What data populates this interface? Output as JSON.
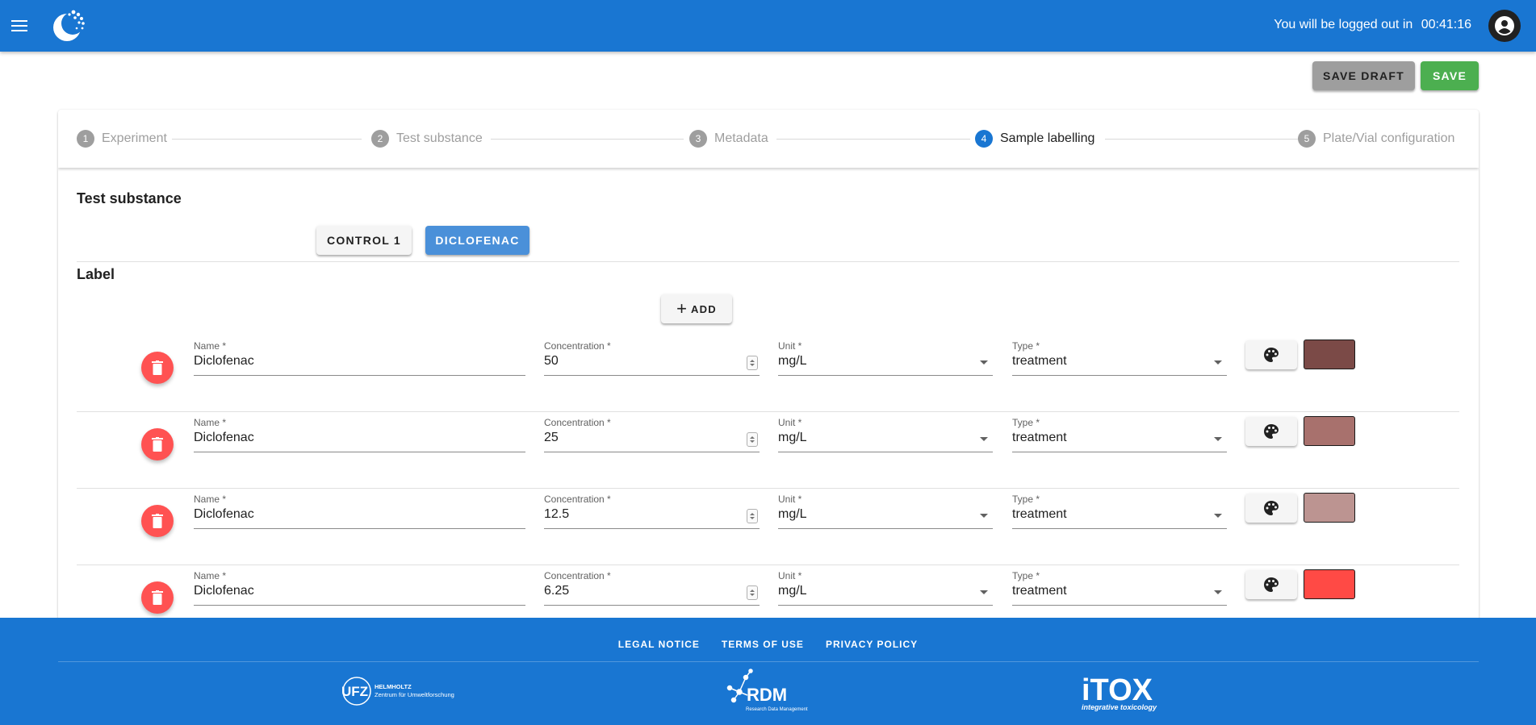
{
  "header": {
    "menu_icon": "menu-icon",
    "logo_icon": "app-logo-icon",
    "logout_prefix": "You will be logged out in",
    "logout_timer": "00:41:16",
    "account_icon": "account-circle-icon"
  },
  "actions": {
    "save_draft": "SAVE DRAFT",
    "save": "SAVE"
  },
  "stepper": {
    "steps": [
      {
        "num": "1",
        "label": "Experiment"
      },
      {
        "num": "2",
        "label": "Test substance"
      },
      {
        "num": "3",
        "label": "Metadata"
      },
      {
        "num": "4",
        "label": "Sample labelling"
      },
      {
        "num": "5",
        "label": "Plate/Vial configuration"
      }
    ],
    "active_step": "4"
  },
  "content": {
    "test_substance_title": "Test substance",
    "substances": [
      "CONTROL 1",
      "DICLOFENAC"
    ],
    "selected_substance": "DICLOFENAC",
    "label_title": "Label",
    "add_label": "ADD"
  },
  "field_labels": {
    "name": "Name *",
    "concentration": "Concentration *",
    "unit": "Unit *",
    "type": "Type *"
  },
  "rows": [
    {
      "name": "Diclofenac",
      "concentration": "50",
      "unit": "mg/L",
      "type": "treatment",
      "color": "#7b4a47"
    },
    {
      "name": "Diclofenac",
      "concentration": "25",
      "unit": "mg/L",
      "type": "treatment",
      "color": "#a8716d"
    },
    {
      "name": "Diclofenac",
      "concentration": "12.5",
      "unit": "mg/L",
      "type": "treatment",
      "color": "#bc9491"
    },
    {
      "name": "Diclofenac",
      "concentration": "6.25",
      "unit": "mg/L",
      "type": "treatment",
      "color": "#ff4a45"
    }
  ],
  "footer": {
    "links": [
      "LEGAL NOTICE",
      "TERMS OF USE",
      "PRIVACY POLICY"
    ],
    "ufz_logo": {
      "mark": "UFZ",
      "line1": "HELMHOLTZ",
      "line2": "Zentrum für Umweltforschung"
    },
    "rdm_logo": {
      "mark": "RDM",
      "line": "Research Data Management"
    },
    "itox_logo": {
      "mark": "iTOX",
      "line": "integrative toxicology"
    }
  },
  "colors": {
    "primary": "#1976d2",
    "save_green": "#4caf50",
    "draft_grey": "#9e9e9e",
    "delete_red": "#ff5252",
    "selected_chip": "#4a90d9"
  }
}
